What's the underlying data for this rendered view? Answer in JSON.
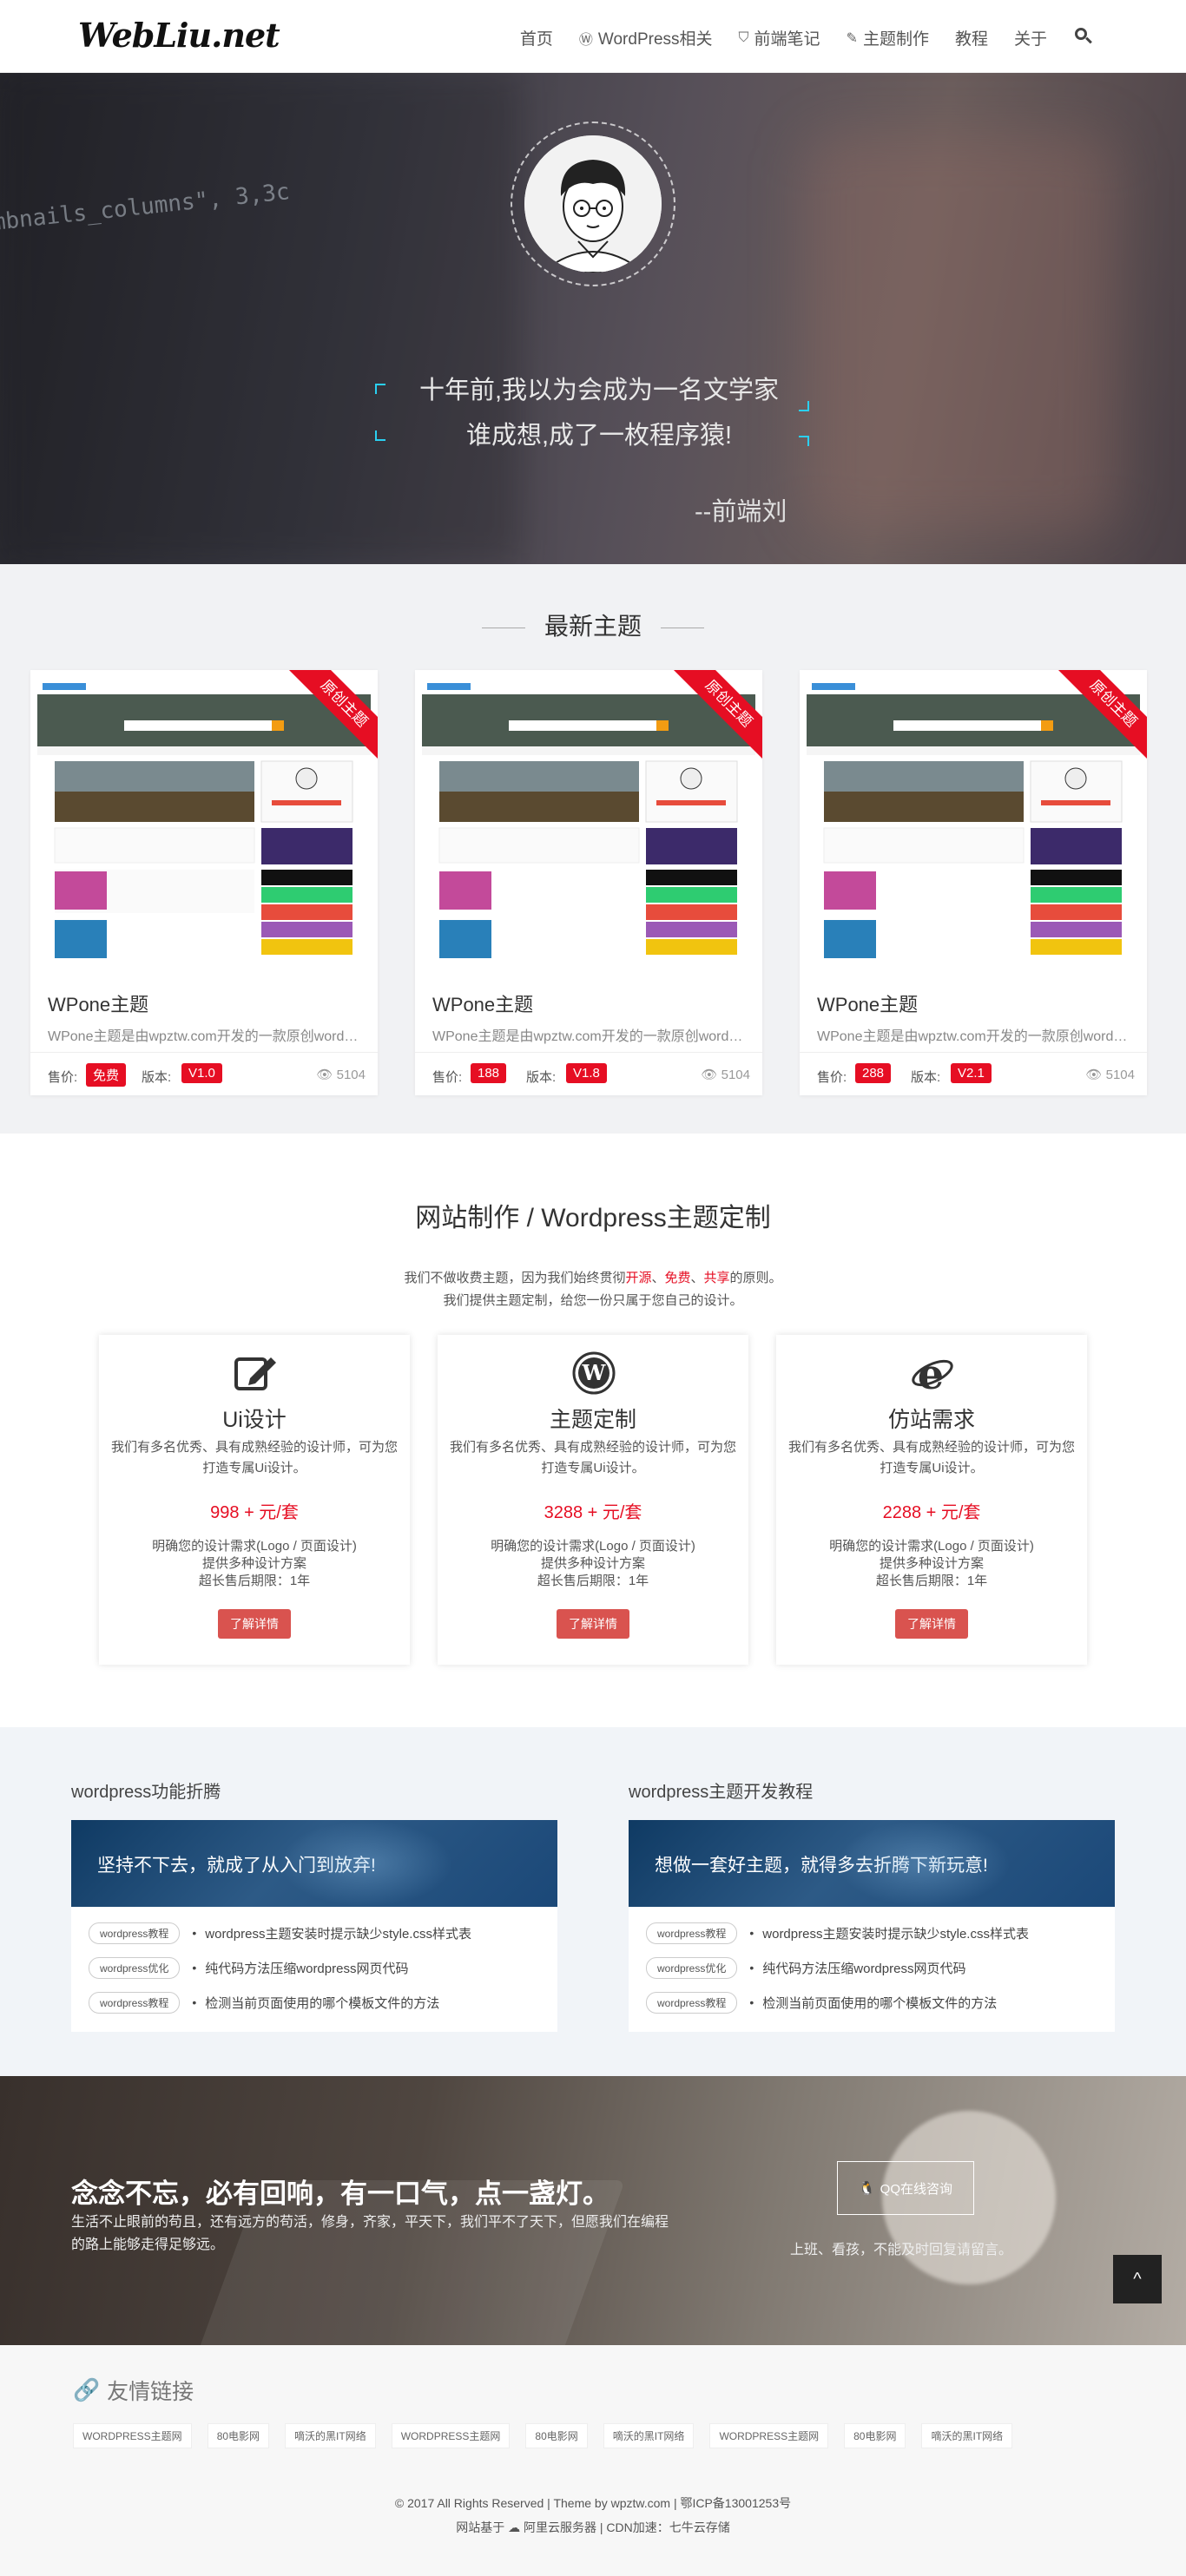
{
  "header": {
    "logo": "WebLiu.net",
    "nav": [
      {
        "label": "首页",
        "icon": ""
      },
      {
        "label": "WordPress相关",
        "icon": "wordpress-icon"
      },
      {
        "label": "前端笔记",
        "icon": "html5-icon"
      },
      {
        "label": "主题制作",
        "icon": "brush-icon"
      },
      {
        "label": "教程",
        "icon": ""
      },
      {
        "label": "关于",
        "icon": ""
      }
    ]
  },
  "hero": {
    "line1": "十年前,我以为会成为一名文学家",
    "line2": "谁成想,成了一枚程序猿!",
    "author": "--前端刘",
    "code": "mbnails_columns\", 3,3c"
  },
  "latest": {
    "title": "最新主题",
    "price_label": "售价:",
    "version_label": "版本:",
    "cards": [
      {
        "ribbon": "原创主题",
        "title": "WPone主题",
        "desc": "WPone主题是由wpztw.com开发的一款原创wordpress...",
        "price": "免费",
        "version": "V1.0",
        "views": "5104"
      },
      {
        "ribbon": "原创主题",
        "title": "WPone主题",
        "desc": "WPone主题是由wpztw.com开发的一款原创wordpress...",
        "price": "188",
        "version": "V1.8",
        "views": "5104"
      },
      {
        "ribbon": "原创主题",
        "title": "WPone主题",
        "desc": "WPone主题是由wpztw.com开发的一款原创wordpress...",
        "price": "288",
        "version": "V2.1",
        "views": "5104"
      }
    ]
  },
  "services": {
    "title": "网站制作 / Wordpress主题定制",
    "sub1_pre": "我们不做收费主题，因为我们始终贯彻",
    "sub1_r1": "开源",
    "sub1_sep1": "、",
    "sub1_r2": "免费",
    "sub1_sep2": "、",
    "sub1_r3": "共享",
    "sub1_post": "的原则。",
    "sub2": "我们提供主题定制，给您一份只属于您自己的设计。",
    "items": [
      {
        "title": "Ui设计",
        "desc": "我们有多名优秀、具有成熟经验的设计师，可为您打造专属Ui设计。",
        "price": "998 + 元/套",
        "f1": "明确您的设计需求(Logo / 页面设计)",
        "f2": "提供多种设计方案",
        "f3": "超长售后期限：1年",
        "btn": "了解详情"
      },
      {
        "title": "主题定制",
        "desc": "我们有多名优秀、具有成熟经验的设计师，可为您打造专属Ui设计。",
        "price": "3288 + 元/套",
        "f1": "明确您的设计需求(Logo / 页面设计)",
        "f2": "提供多种设计方案",
        "f3": "超长售后期限：1年",
        "btn": "了解详情"
      },
      {
        "title": "仿站需求",
        "desc": "我们有多名优秀、具有成熟经验的设计师，可为您打造专属Ui设计。",
        "price": "2288 + 元/套",
        "f1": "明确您的设计需求(Logo / 页面设计)",
        "f2": "提供多种设计方案",
        "f3": "超长售后期限：1年",
        "btn": "了解详情"
      }
    ]
  },
  "tutorials": [
    {
      "head": "wordpress功能折腾",
      "banner": "坚持不下去，就成了从入门到放弃!",
      "items": [
        {
          "tag": "wordpress教程",
          "text": "wordpress主题安装时提示缺少style.css样式表"
        },
        {
          "tag": "wordpress优化",
          "text": "纯代码方法压缩wordpress网页代码"
        },
        {
          "tag": "wordpress教程",
          "text": "检测当前页面使用的哪个模板文件的方法"
        }
      ]
    },
    {
      "head": "wordpress主题开发教程",
      "banner": "想做一套好主题，就得多去折腾下新玩意!",
      "items": [
        {
          "tag": "wordpress教程",
          "text": "wordpress主题安装时提示缺少style.css样式表"
        },
        {
          "tag": "wordpress优化",
          "text": "纯代码方法压缩wordpress网页代码"
        },
        {
          "tag": "wordpress教程",
          "text": "检测当前页面使用的哪个模板文件的方法"
        }
      ]
    }
  ],
  "cta": {
    "title": "念念不忘，必有回响，有一口气，点一盏灯。",
    "text": "生活不止眼前的苟且，还有远方的苟活，修身，齐家，平天下，我们平不了天下，但愿我们在编程的路上能够走得足够远。",
    "qq_label": "QQ在线咨询",
    "note": "上班、看孩，不能及时回复请留言。",
    "totop": "^"
  },
  "links": {
    "title": "友情链接",
    "items": [
      "WORDPRESS主题网",
      "80电影网",
      "嘀沃的黑IT网络",
      "WORDPRESS主题网",
      "80电影网",
      "嘀沃的黑IT网络",
      "WORDPRESS主题网",
      "80电影网",
      "嘀沃的黑IT网络"
    ]
  },
  "footer": {
    "line1": "© 2017 All Rights Reserved | Theme by wpztw.com | 鄂ICP备13001253号",
    "line2": "网站基于 ☁ 阿里云服务器 | CDN加速：七牛云存储"
  },
  "colors": {
    "accent_red": "#e60e23",
    "banner_blue": "#1b4878",
    "corner_cyan": "#2ad0f2"
  }
}
